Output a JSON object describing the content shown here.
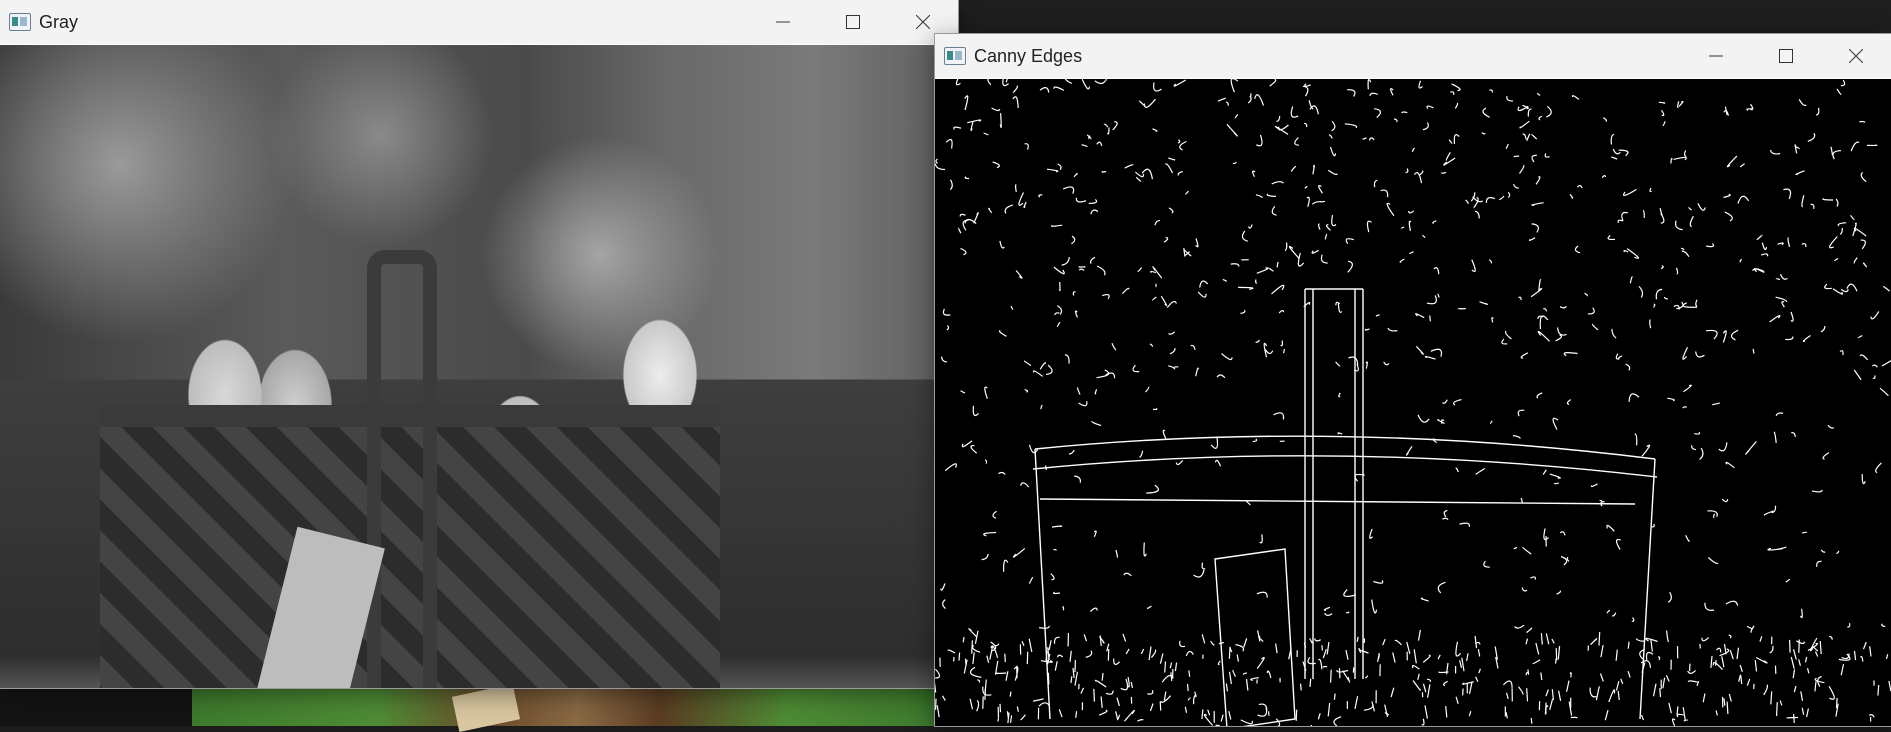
{
  "windows": {
    "gray": {
      "title": "Gray",
      "controls": {
        "minimize": "minimize",
        "maximize": "maximize",
        "close": "close"
      }
    },
    "canny": {
      "title": "Canny Edges",
      "controls": {
        "minimize": "minimize",
        "maximize": "maximize",
        "close": "close"
      }
    }
  },
  "icons": {
    "app": "app-window-icon",
    "minimize": "minimize-icon",
    "maximize": "maximize-icon",
    "close": "close-icon"
  },
  "colors": {
    "titlebar": "#f3f3f3",
    "edges_background": "#000000",
    "edges_stroke": "#ffffff"
  }
}
